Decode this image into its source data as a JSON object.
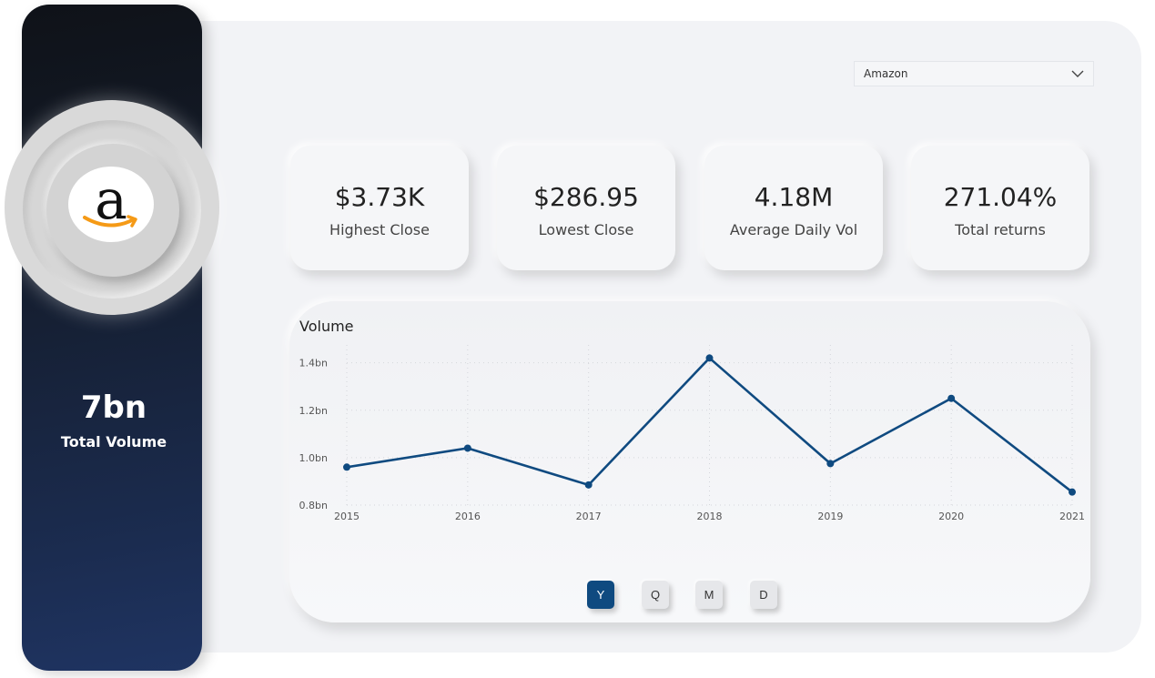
{
  "sidebar": {
    "logo_letter": "a",
    "total_volume_value": "7bn",
    "total_volume_label": "Total Volume"
  },
  "filter": {
    "selected": "Amazon",
    "icon": "chevron-down-icon"
  },
  "kpis": [
    {
      "value": "$3.73K",
      "label": "Highest Close"
    },
    {
      "value": "$286.95",
      "label": "Lowest Close"
    },
    {
      "value": "4.18M",
      "label": "Average Daily Vol"
    },
    {
      "value": "271.04%",
      "label": "Total returns"
    }
  ],
  "chart": {
    "title": "Volume",
    "period_buttons": [
      {
        "label": "Y",
        "active": true
      },
      {
        "label": "Q",
        "active": false
      },
      {
        "label": "M",
        "active": false
      },
      {
        "label": "D",
        "active": false
      }
    ]
  },
  "chart_data": {
    "type": "line",
    "title": "Volume",
    "x": [
      "2015",
      "2016",
      "2017",
      "2018",
      "2019",
      "2020",
      "2021"
    ],
    "series": [
      {
        "values": [
          0.96,
          1.04,
          0.885,
          1.42,
          0.975,
          1.25,
          0.855
        ]
      }
    ],
    "y_ticks": [
      "0.8bn",
      "1.0bn",
      "1.2bn",
      "1.4bn"
    ],
    "y_tick_values": [
      0.8,
      1.0,
      1.2,
      1.4
    ],
    "ylim": [
      0.8,
      1.46
    ],
    "grid": true,
    "colors": {
      "line": "#0f4a80",
      "grid": "#d4d6db"
    }
  }
}
